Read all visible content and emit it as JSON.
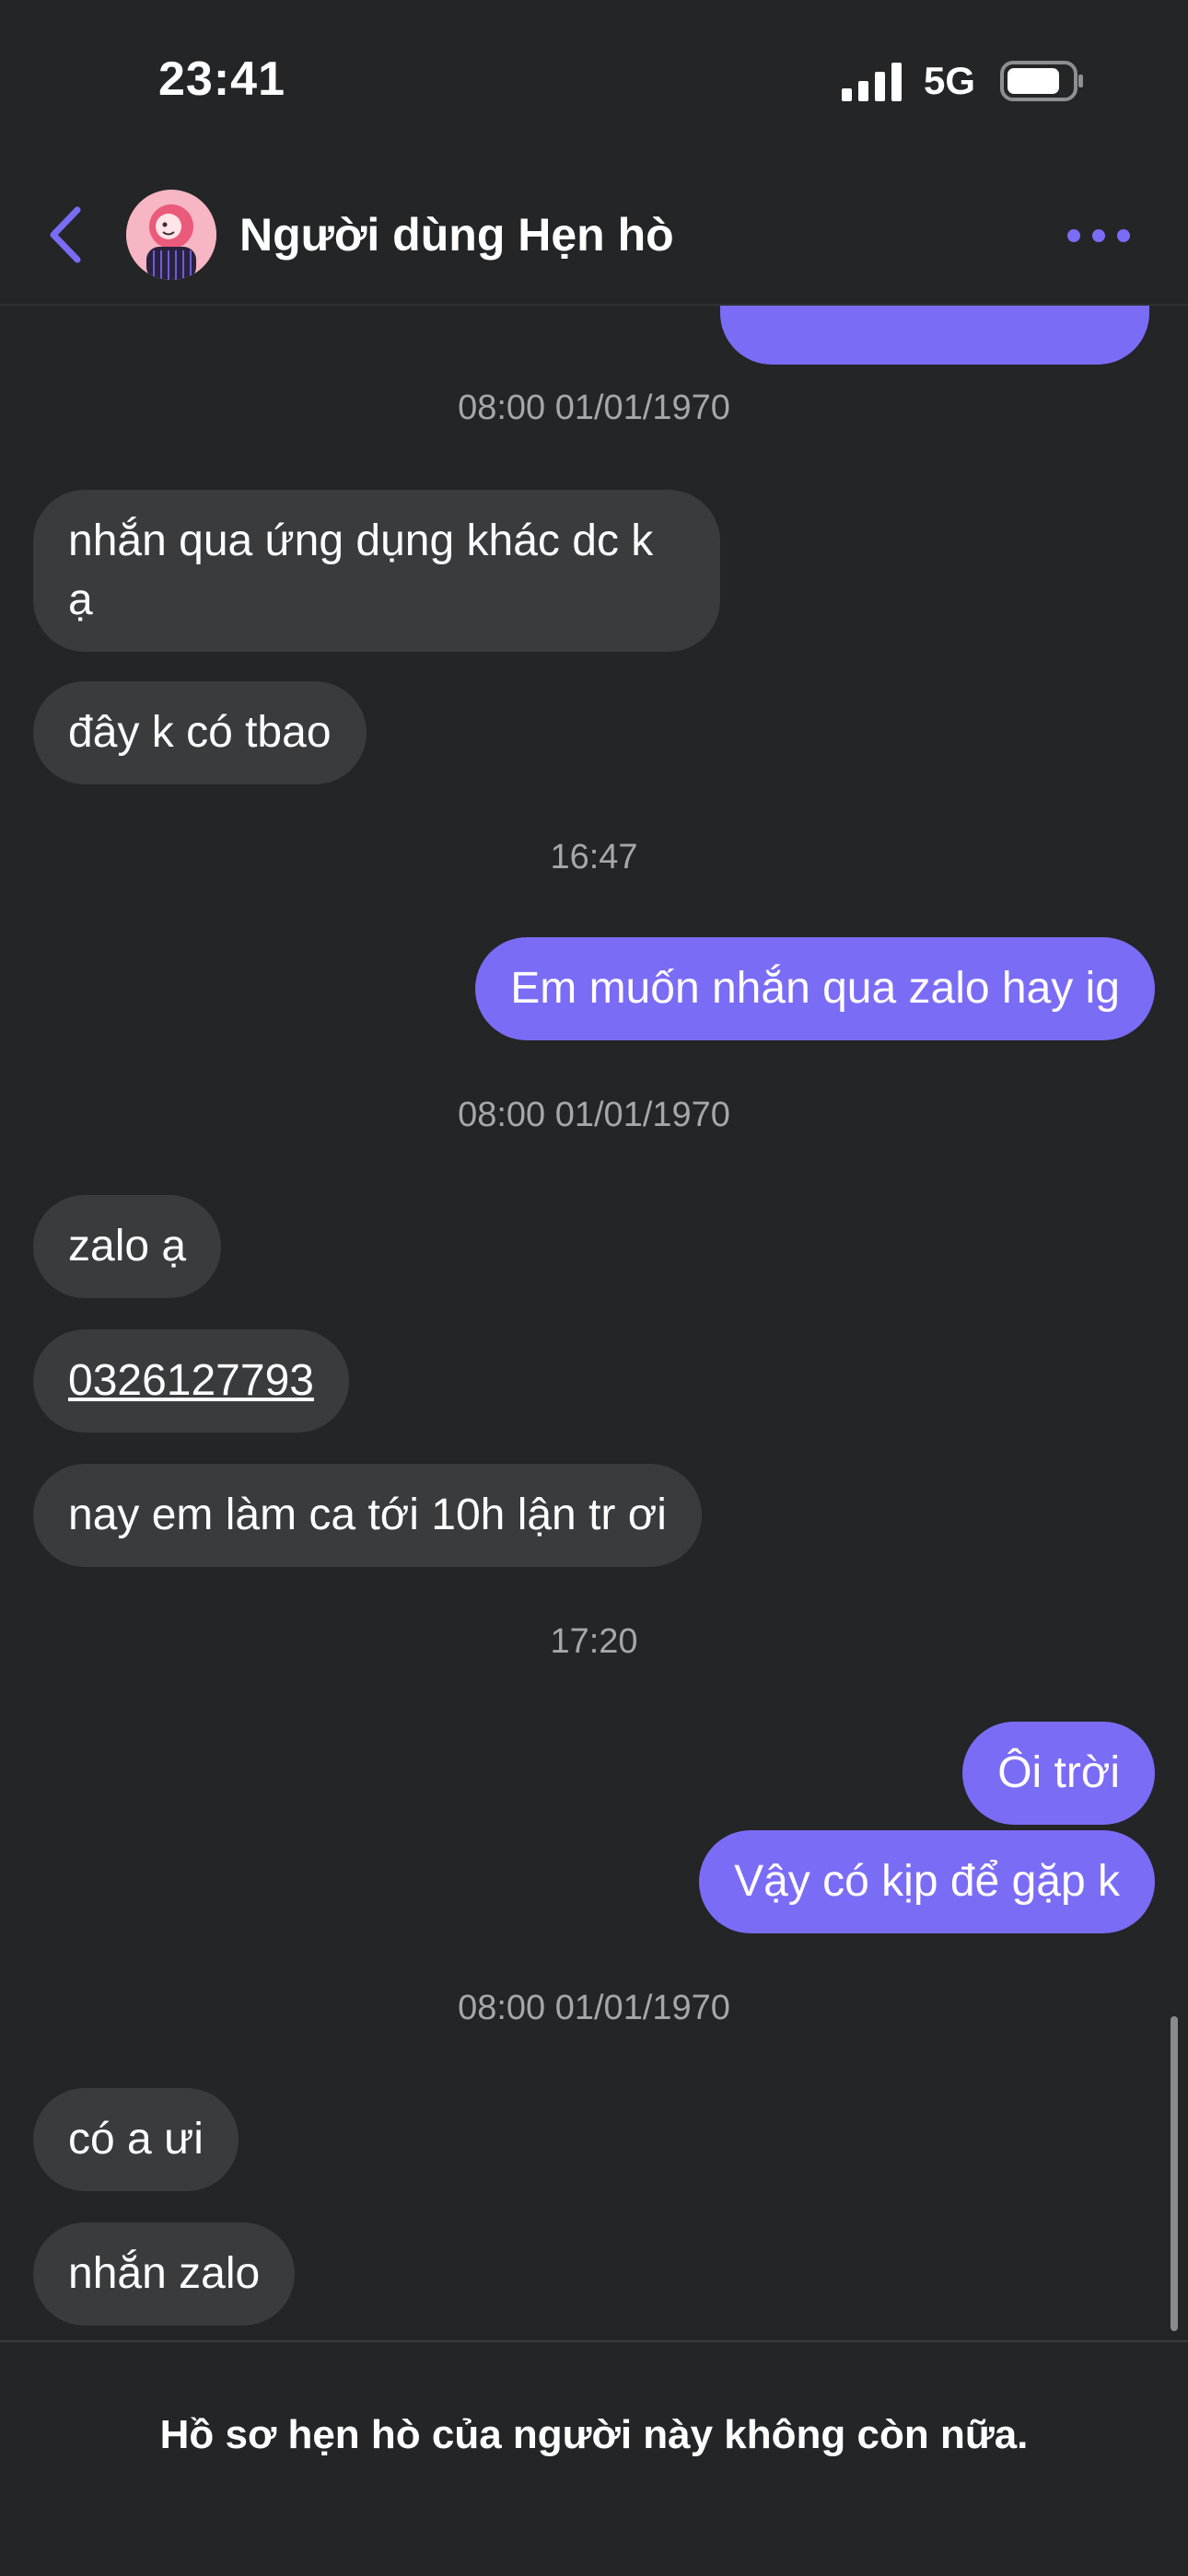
{
  "status_bar": {
    "time": "23:41",
    "network": "5G",
    "signal_icon": "signal-bars-icon",
    "battery_icon": "battery-icon"
  },
  "header": {
    "back_icon": "chevron-left-icon",
    "avatar_icon": "avatar",
    "contact_name": "Người dùng Hẹn hò",
    "more_icon": "more-horizontal-icon",
    "accent_color": "#7b6cf6"
  },
  "messages": {
    "top_partial_bubble": "",
    "ts1": "08:00 01/01/1970",
    "m1": "nhắn qua ứng dụng khác dc k ạ",
    "m2": "đây k có tbao",
    "ts2": "16:47",
    "m3": "Em muốn nhắn qua zalo hay ig",
    "ts3": "08:00 01/01/1970",
    "m4": "zalo ạ",
    "m5": "0326127793",
    "m6": "nay em làm ca tới 10h lận tr ơi",
    "ts4": "17:20",
    "m7": "Ôi trời",
    "m8": "Vậy có kịp để gặp k",
    "ts5": "08:00 01/01/1970",
    "m9": "có a ưi",
    "m10": "nhắn zalo"
  },
  "footer": {
    "notice": "Hồ sơ hẹn hò của người này không còn nữa."
  },
  "colors": {
    "background": "#242526",
    "incoming_bubble": "#3a3b3d",
    "outgoing_bubble": "#7b6cf6",
    "timestamp_text": "#a6a7ab"
  }
}
